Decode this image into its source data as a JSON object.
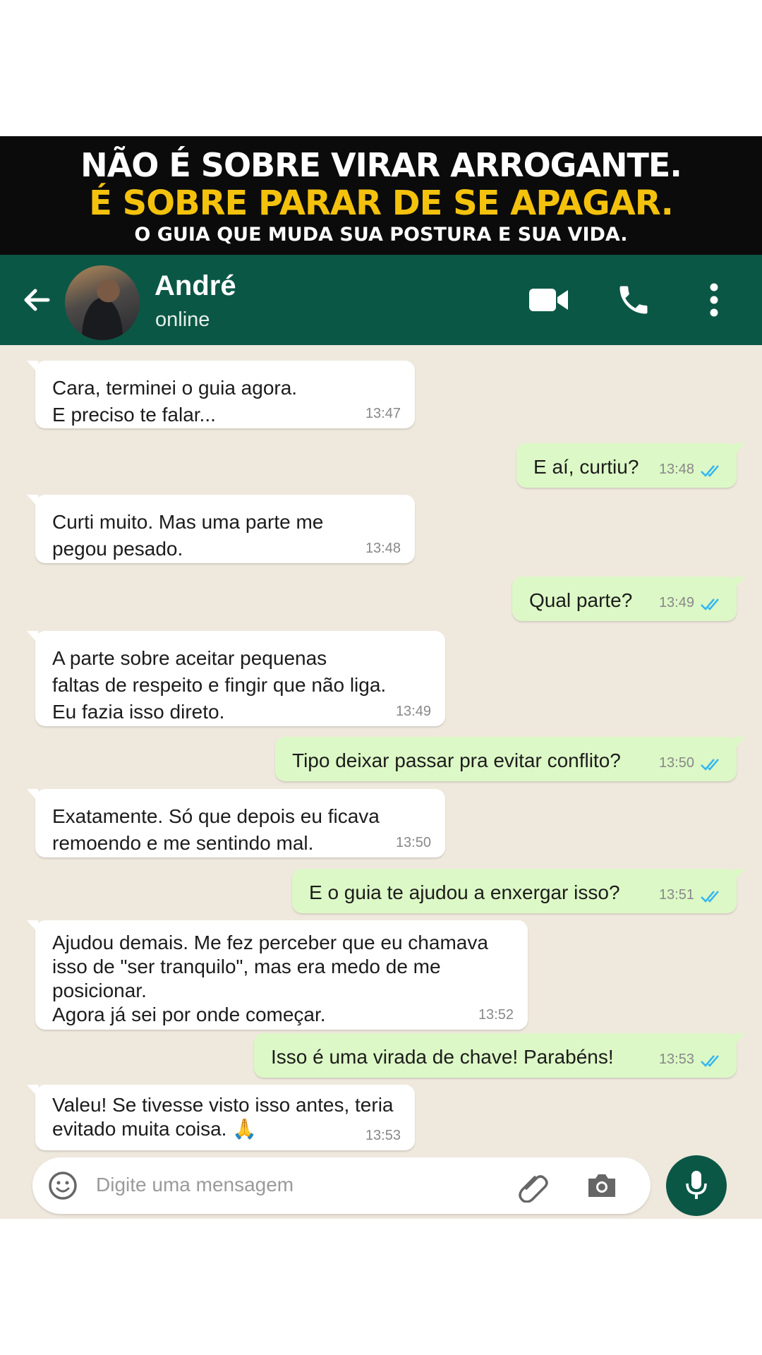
{
  "banner": {
    "line1": "NÃO É SOBRE VIRAR ARROGANTE.",
    "line2": "É SOBRE PARAR DE SE APAGAR.",
    "line3": "O GUIA QUE MUDA SUA POSTURA E SUA VIDA."
  },
  "header": {
    "contact_name": "André",
    "status": "online",
    "icons": [
      "back-arrow-icon",
      "video-call-icon",
      "voice-call-icon",
      "more-options-icon"
    ]
  },
  "messages": [
    {
      "dir": "in",
      "text": "Cara, terminei o guia agora.\nE preciso te falar...",
      "time": "13:47"
    },
    {
      "dir": "out",
      "text": "E aí, curtiu?",
      "time": "13:48"
    },
    {
      "dir": "in",
      "text": "Curti muito. Mas uma parte me\npegou pesado.",
      "time": "13:48"
    },
    {
      "dir": "out",
      "text": "Qual parte?",
      "time": "13:49"
    },
    {
      "dir": "in",
      "text": "A parte sobre aceitar pequenas\nfaltas de respeito e fingir que não liga.\nEu fazia isso direto.",
      "time": "13:49"
    },
    {
      "dir": "out",
      "text": "Tipo deixar passar pra evitar conflito?",
      "time": "13:50"
    },
    {
      "dir": "in",
      "text": "Exatamente. Só que depois eu ficava\nremoendo e me sentindo mal.",
      "time": "13:50"
    },
    {
      "dir": "out",
      "text": "E o guia te ajudou a enxergar isso?",
      "time": "13:51"
    },
    {
      "dir": "in",
      "text": "Ajudou demais. Me fez perceber que eu chamava\nisso de \"ser tranquilo\", mas era medo de me\nposicionar.\nAgora já sei por onde começar.",
      "time": "13:52"
    },
    {
      "dir": "out",
      "text": "Isso é uma virada de chave! Parabéns!",
      "time": "13:53"
    },
    {
      "dir": "in",
      "text": "Valeu! Se tivesse visto isso antes, teria\nevitado muita coisa. 🙏",
      "time": "13:53"
    }
  ],
  "input": {
    "placeholder": "Digite uma mensagem",
    "icons": [
      "emoji-icon",
      "attach-icon",
      "camera-icon",
      "microphone-icon"
    ]
  },
  "colors": {
    "header": "#0b5746",
    "banner_accent": "#f4c20d",
    "chat_bg": "#efe8dd",
    "bubble_out": "#dcf8c6",
    "bubble_in": "#ffffff",
    "read_ticks": "#34b7f1"
  }
}
